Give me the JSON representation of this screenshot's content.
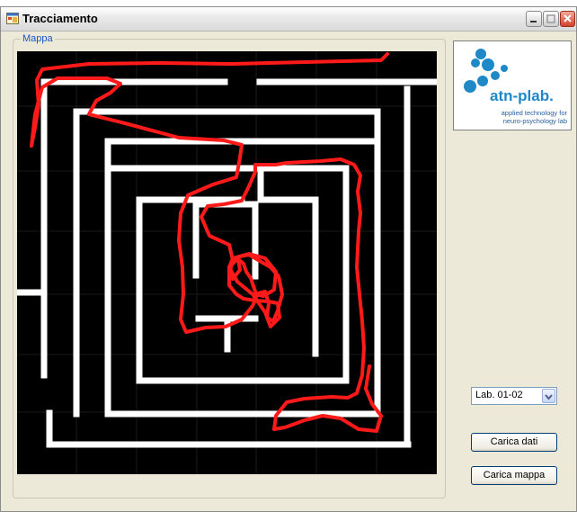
{
  "window": {
    "title": "Tracciamento"
  },
  "map_group": {
    "label": "Mappa"
  },
  "logo": {
    "brand": "atn-plab.",
    "tagline_line1": "applied technology for",
    "tagline_line2": "neuro-psychology lab",
    "brand_color": "#1f88c7"
  },
  "controls": {
    "lab_select_value": "Lab. 01-02",
    "load_data_button": "Carica dati",
    "load_map_button": "Carica mappa"
  },
  "colors": {
    "window_bg": "#ece9d8",
    "maze_bg": "#000000",
    "maze_wall": "#ffffff",
    "path_trace": "#ff1a1a",
    "group_title": "#1b52c9"
  }
}
